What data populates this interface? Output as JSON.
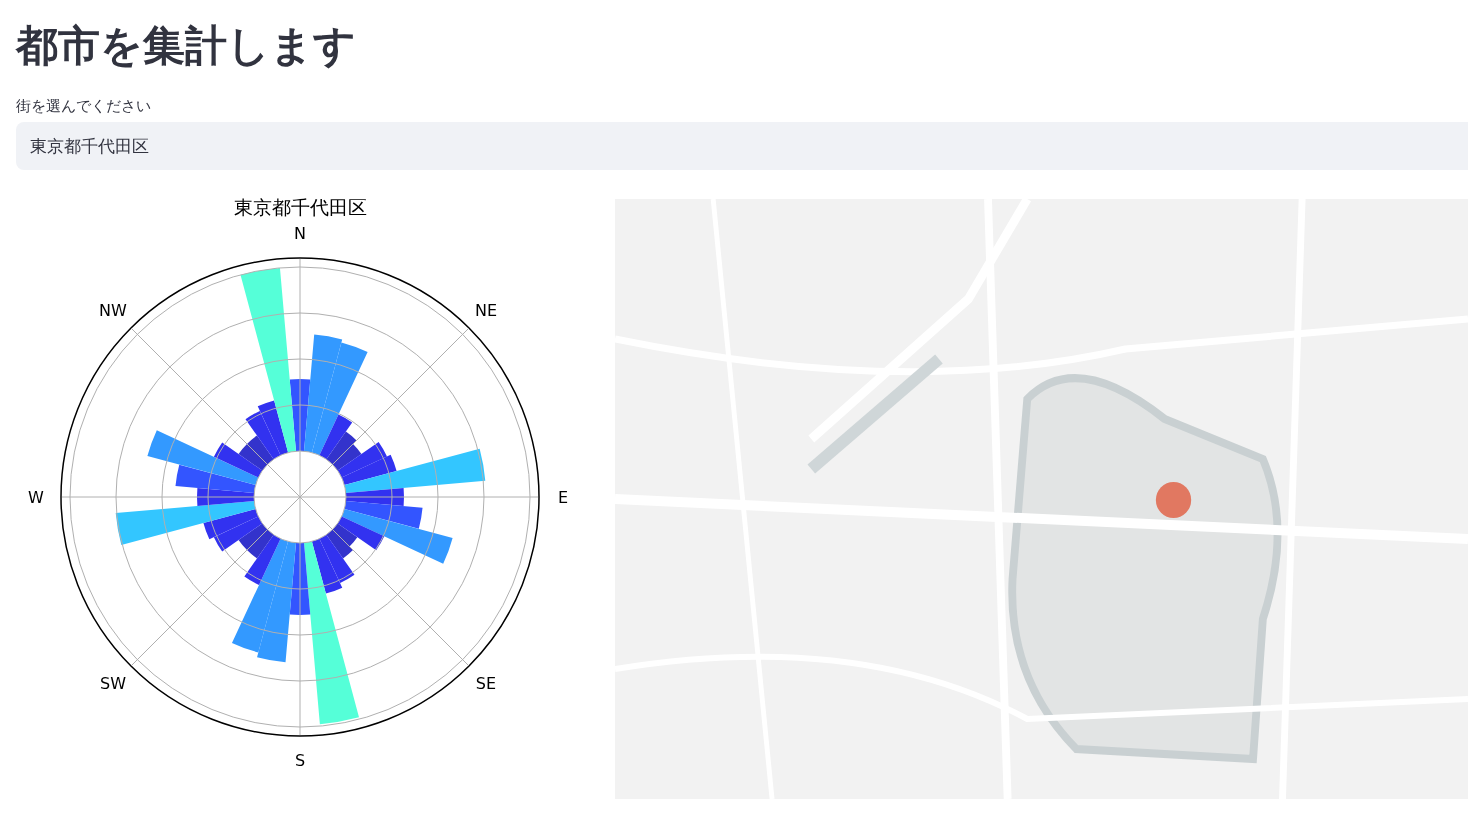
{
  "heading": "都市を集計します",
  "select": {
    "label": "街を選んでください",
    "value": "東京都千代田区"
  },
  "rose_chart": {
    "title": "東京都千代田区",
    "directions": [
      "N",
      "NE",
      "E",
      "SE",
      "S",
      "SW",
      "W",
      "NW"
    ]
  }
}
